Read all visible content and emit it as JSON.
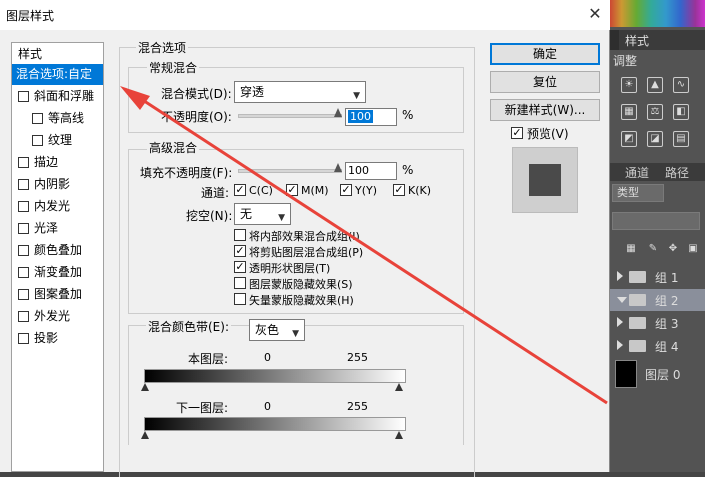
{
  "window": {
    "title": "图层样式",
    "close_icon": "close-icon"
  },
  "left_list": {
    "header": "样式",
    "items": [
      {
        "label": "混合选项:自定",
        "checkbox": false,
        "selected": true
      },
      {
        "label": "斜面和浮雕",
        "checkbox": true,
        "checked": false
      },
      {
        "label": "等高线",
        "checkbox": true,
        "checked": false,
        "indent": true
      },
      {
        "label": "纹理",
        "checkbox": true,
        "checked": false,
        "indent": true
      },
      {
        "label": "描边",
        "checkbox": true,
        "checked": false
      },
      {
        "label": "内阴影",
        "checkbox": true,
        "checked": false
      },
      {
        "label": "内发光",
        "checkbox": true,
        "checked": false
      },
      {
        "label": "光泽",
        "checkbox": true,
        "checked": false
      },
      {
        "label": "颜色叠加",
        "checkbox": true,
        "checked": false
      },
      {
        "label": "渐变叠加",
        "checkbox": true,
        "checked": false
      },
      {
        "label": "图案叠加",
        "checkbox": true,
        "checked": false
      },
      {
        "label": "外发光",
        "checkbox": true,
        "checked": false
      },
      {
        "label": "投影",
        "checkbox": true,
        "checked": false
      }
    ]
  },
  "blend_options": {
    "group_title": "混合选项",
    "general": {
      "title": "常规混合",
      "mode_label": "混合模式(D):",
      "mode_value": "穿透",
      "opacity_label": "不透明度(O):",
      "opacity_value": "100",
      "opacity_unit": "%",
      "opacity_level": 1.0
    },
    "advanced": {
      "title": "高级混合",
      "fill_label": "填充不透明度(F):",
      "fill_value": "100",
      "fill_unit": "%",
      "fill_level": 1.0,
      "channels_label": "通道:",
      "channels": [
        {
          "label": "C(C)",
          "checked": true
        },
        {
          "label": "M(M)",
          "checked": true
        },
        {
          "label": "Y(Y)",
          "checked": true
        },
        {
          "label": "K(K)",
          "checked": true
        }
      ],
      "knockout_label": "挖空(N):",
      "knockout_value": "无",
      "options": [
        {
          "label": "将内部效果混合成组(I)",
          "checked": false
        },
        {
          "label": "将剪贴图层混合成组(P)",
          "checked": true
        },
        {
          "label": "透明形状图层(T)",
          "checked": true
        },
        {
          "label": "图层蒙版隐藏效果(S)",
          "checked": false
        },
        {
          "label": "矢量蒙版隐藏效果(H)",
          "checked": false
        }
      ]
    },
    "blend_if": {
      "label": "混合颜色带(E):",
      "value": "灰色",
      "this_layer_label": "本图层:",
      "this_layer_min": "0",
      "this_layer_max": "255",
      "under_layer_label": "下一图层:",
      "under_layer_min": "0",
      "under_layer_max": "255"
    }
  },
  "buttons": {
    "ok": "确定",
    "reset": "复位",
    "new_style": "新建样式(W)...",
    "preview_label": "预览(V)",
    "preview_checked": true
  },
  "ps_panel": {
    "styles_tab": "样式",
    "adjust_label": "调整",
    "channels_tab": "通道",
    "paths_tab": "路径",
    "kind_label": "类型",
    "layers": [
      {
        "label": "组 1",
        "expanded": false,
        "selected": false
      },
      {
        "label": "组 2",
        "expanded": true,
        "selected": true
      },
      {
        "label": "组 3",
        "expanded": false,
        "selected": false
      },
      {
        "label": "组 4",
        "expanded": false,
        "selected": false
      },
      {
        "label": "图层 0",
        "expanded": false,
        "selected": false,
        "thumb": true
      }
    ]
  },
  "colors": {
    "accent": "#0078d7",
    "annotation_arrow": "#e8433a",
    "ps_bg": "#535353"
  }
}
